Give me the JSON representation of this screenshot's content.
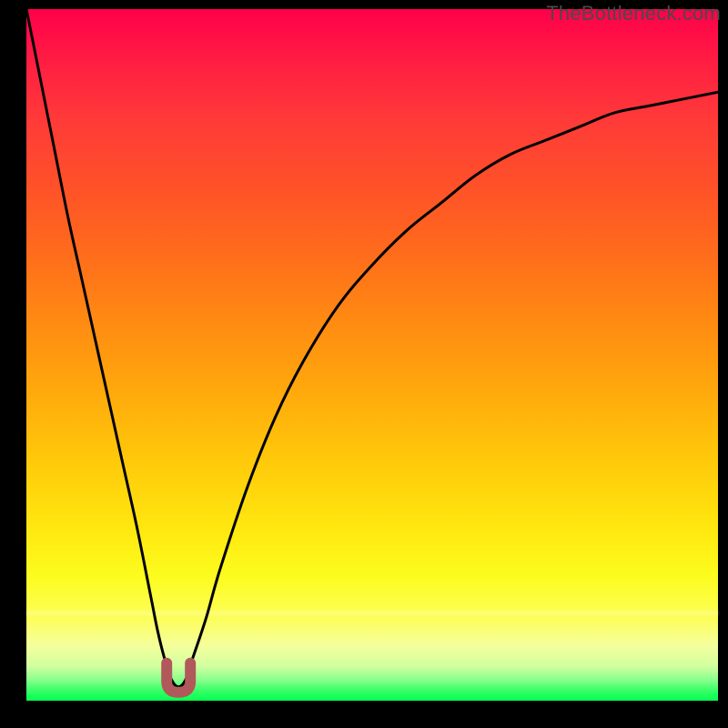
{
  "watermark": "TheBottleneck.com",
  "colors": {
    "curve": "#000000",
    "cusp_marker": "#b1585a",
    "frame": "#000000"
  },
  "chart_data": {
    "type": "line",
    "title": "",
    "xlabel": "",
    "ylabel": "",
    "xlim": [
      0,
      100
    ],
    "ylim": [
      0,
      100
    ],
    "series": [
      {
        "name": "bottleneck-curve",
        "x": [
          0,
          2,
          4,
          6,
          8,
          10,
          12,
          14,
          16,
          18,
          19,
          20,
          21,
          22,
          23,
          24,
          26,
          28,
          32,
          36,
          40,
          45,
          50,
          55,
          60,
          65,
          70,
          75,
          80,
          85,
          90,
          95,
          100
        ],
        "y": [
          100,
          90,
          80,
          70,
          61,
          52,
          43,
          34,
          25,
          15,
          10,
          6,
          3,
          2,
          3,
          6,
          12,
          19,
          31,
          41,
          49,
          57,
          63,
          68,
          72,
          76,
          79,
          81,
          83,
          85,
          86,
          87,
          88
        ]
      }
    ],
    "cusp_x": 22,
    "cusp_y": 2,
    "annotation": "cusp-marker"
  }
}
